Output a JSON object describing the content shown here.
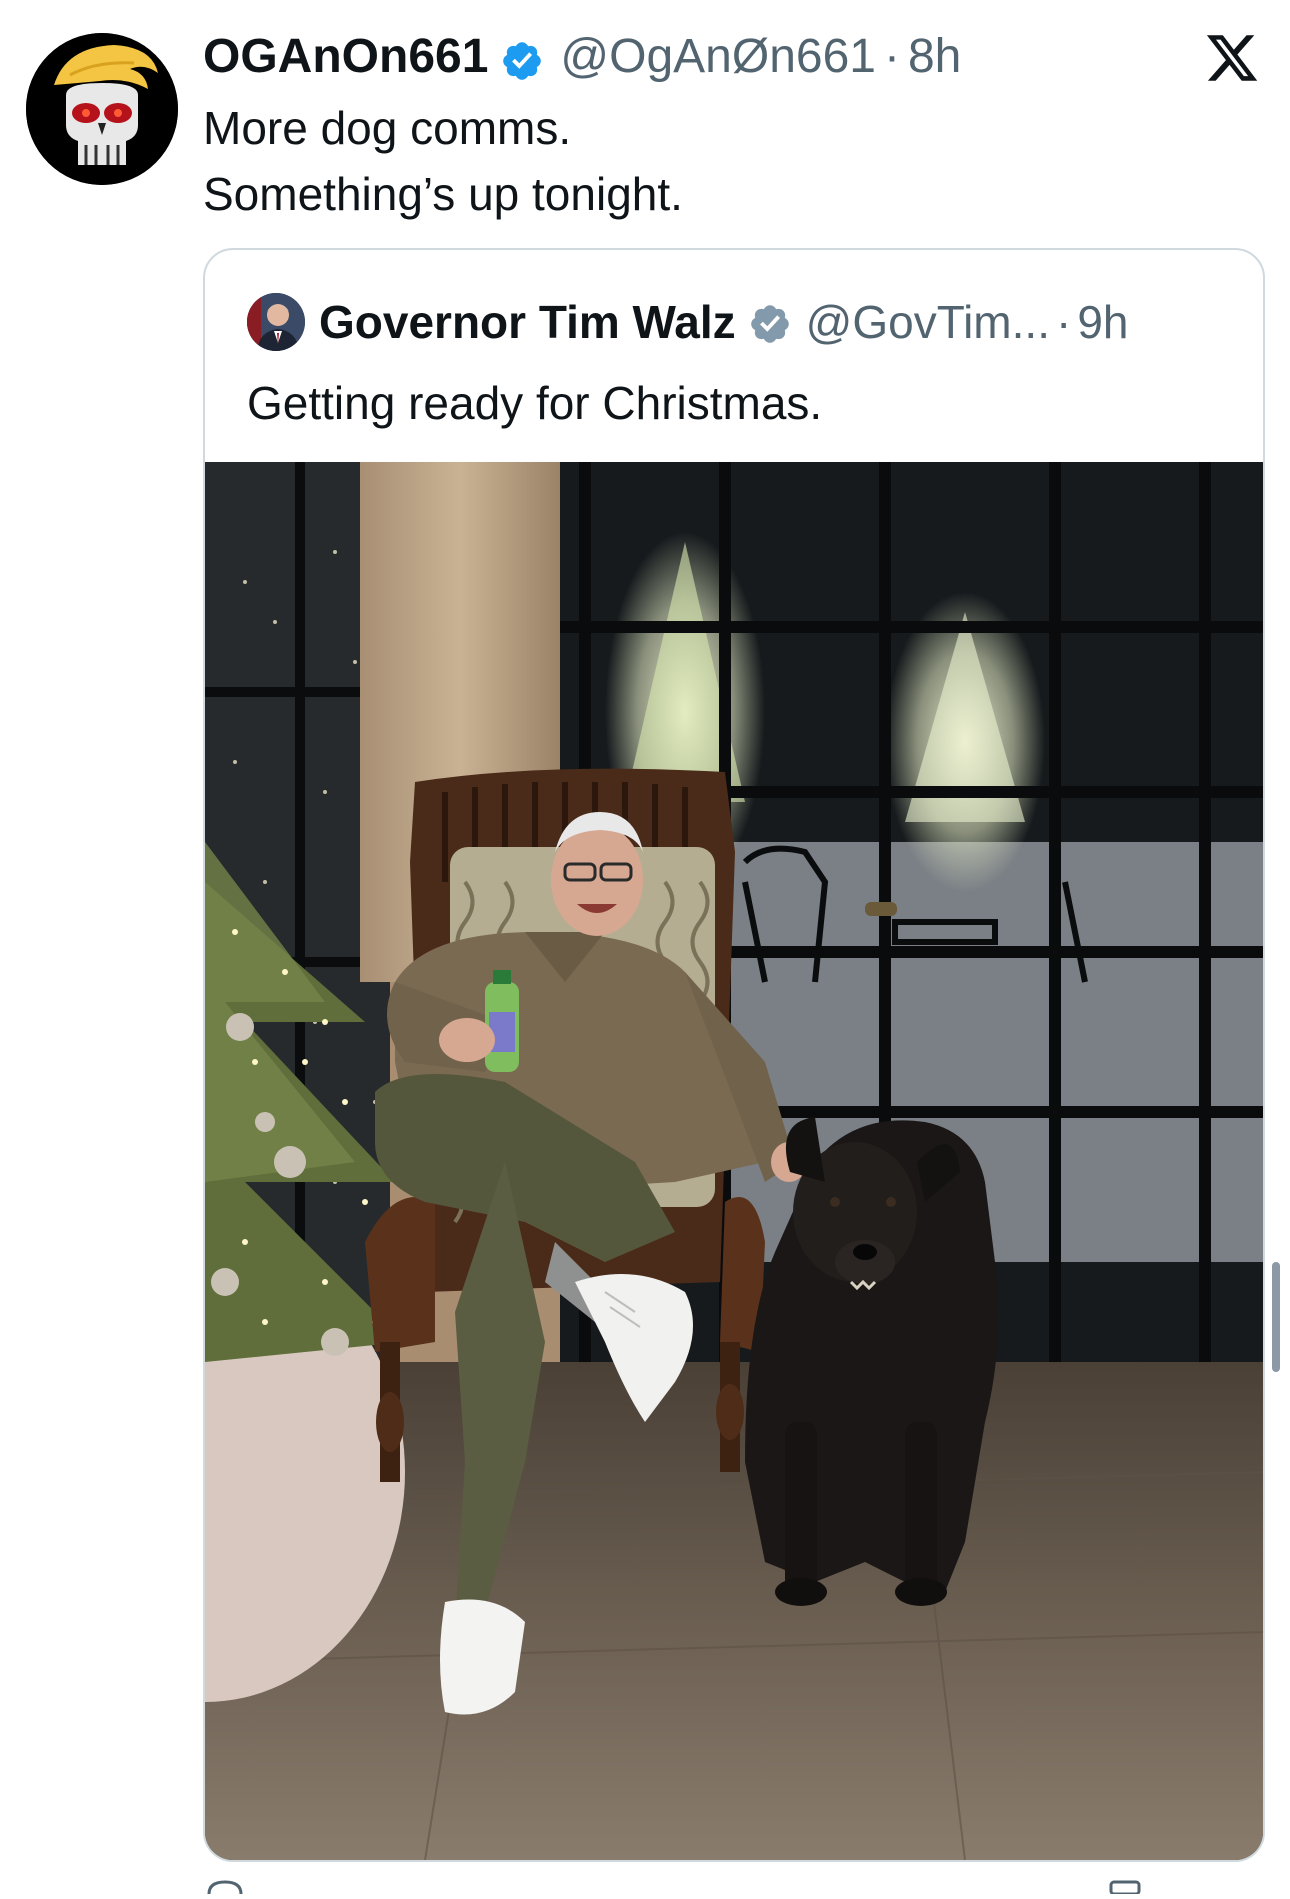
{
  "tweet": {
    "author": {
      "display_name": "OGAnOn661",
      "handle": "@OgAnØn661",
      "verified": true,
      "avatar_icon": "punisher-skull-avatar"
    },
    "separator": "·",
    "time": "8h",
    "text_lines": [
      "More dog comms.",
      "Something’s up tonight."
    ]
  },
  "app": {
    "logo_icon": "x-logo-icon"
  },
  "quoted_tweet": {
    "author": {
      "display_name": "Governor Tim Walz",
      "handle": "@GovTim...",
      "verified": true,
      "avatar_icon": "governor-portrait-avatar"
    },
    "separator": "·",
    "time": "9h",
    "text": "Getting ready for Christmas.",
    "photo": "man-in-armchair-with-black-dog-by-christmas-tree"
  },
  "colors": {
    "text_primary": "#0f1419",
    "text_secondary": "#536471",
    "verified_blue": "#1d9bf0",
    "border": "#cfd9de"
  }
}
